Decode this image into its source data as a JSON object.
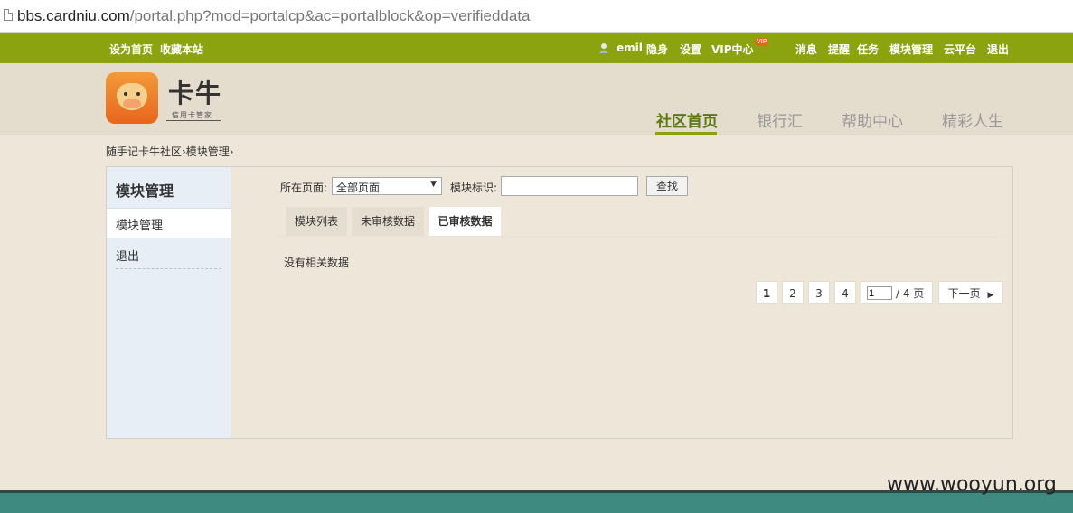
{
  "browser": {
    "url_host": "bbs.cardniu.com",
    "url_path": "/portal.php?mod=portalcp&ac=portalblock&op=verifieddata"
  },
  "topbar": {
    "set_home": "设为首页",
    "bookmark": "收藏本站",
    "username": "emil",
    "invisible": "隐身",
    "settings": "设置",
    "vip": "VIP中心",
    "vip_badge": "VIP",
    "messages": "消息",
    "reminders": "提醒",
    "tasks": "任务",
    "block_manage": "模块管理",
    "cloud": "云平台",
    "logout": "退出"
  },
  "logo": {
    "title": "卡牛",
    "subtitle": "信用卡管家"
  },
  "nav": [
    {
      "label": "社区首页",
      "active": true
    },
    {
      "label": "银行汇",
      "active": false
    },
    {
      "label": "帮助中心",
      "active": false
    },
    {
      "label": "精彩人生",
      "active": false
    }
  ],
  "breadcrumb": "随手记卡牛社区›模块管理›",
  "sidebar": {
    "title": "模块管理",
    "items": [
      {
        "label": "模块管理",
        "active": true
      },
      {
        "label": "退出",
        "active": false
      }
    ]
  },
  "filter": {
    "page_label": "所在页面:",
    "page_value": "全部页面",
    "block_id_label": "模块标识:",
    "block_id_value": "",
    "search_button": "查找"
  },
  "tabs": [
    {
      "label": "模块列表",
      "active": false
    },
    {
      "label": "未审核数据",
      "active": false
    },
    {
      "label": "已审核数据",
      "active": true
    }
  ],
  "empty_message": "没有相关数据",
  "pagination": {
    "pages": [
      "1",
      "2",
      "3",
      "4"
    ],
    "current": "1",
    "input_value": "1",
    "total_text": "/ 4 页",
    "next_label": "下一页"
  },
  "watermark": "www.wooyun.org",
  "colors": {
    "topbar": "#8aa30f",
    "footer": "#3e8a80",
    "active_nav": "#5a7a0d"
  }
}
